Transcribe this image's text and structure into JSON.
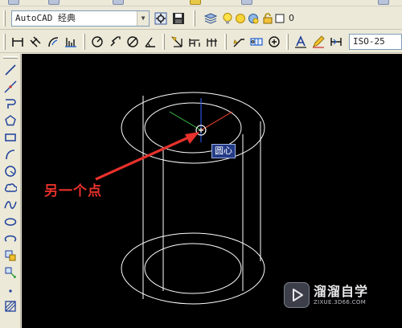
{
  "workspace": {
    "selected": "AutoCAD 经典"
  },
  "layer": {
    "current": "0"
  },
  "dimstyle": {
    "selected": "ISO-25"
  },
  "tooltip": {
    "snap_label": "圆心"
  },
  "annotation": {
    "text": "另一个点"
  },
  "watermark": {
    "brand": "溜溜自学",
    "url": "ZIXUE.3D66.COM"
  },
  "colors": {
    "drawing_background": "#000000",
    "geometry_lines": "#ffffff",
    "annotation": "#e8312c",
    "tooltip_background": "#233a86",
    "ucs_x_axis": "#d23a2a",
    "ucs_y_axis": "#2e9a3a",
    "ucs_z_axis": "#2a4fd8"
  },
  "icons": {
    "toolbar_row_1": [
      "workspace-settings-icon",
      "save-workspace-icon",
      "layer-manager-icon",
      "lightbulb-icon",
      "sun-icon",
      "layer-freeze-icon",
      "lock-icon",
      "layer-color-icon"
    ],
    "toolbar_row_2": [
      "linear-dimension-icon",
      "aligned-dimension-icon",
      "arc-length-icon",
      "ordinate-dimension-icon",
      "radius-dimension-icon",
      "jogged-dimension-icon",
      "diameter-dimension-icon",
      "angular-dimension-icon",
      "quick-dimension-icon",
      "baseline-dimension-icon",
      "continue-dimension-icon",
      "quick-leader-icon",
      "tolerance-icon",
      "center-mark-icon",
      "dimension-edit-icon",
      "dimension-text-edit-icon",
      "dimension-update-icon"
    ],
    "draw_toolbar": [
      "line-icon",
      "construction-line-icon",
      "polyline-icon",
      "polygon-icon",
      "rectangle-icon",
      "arc-icon",
      "circle-icon",
      "revision-cloud-icon",
      "spline-icon",
      "ellipse-icon",
      "ellipse-arc-icon",
      "insert-block-icon",
      "make-block-icon",
      "point-icon",
      "hatch-icon"
    ]
  }
}
